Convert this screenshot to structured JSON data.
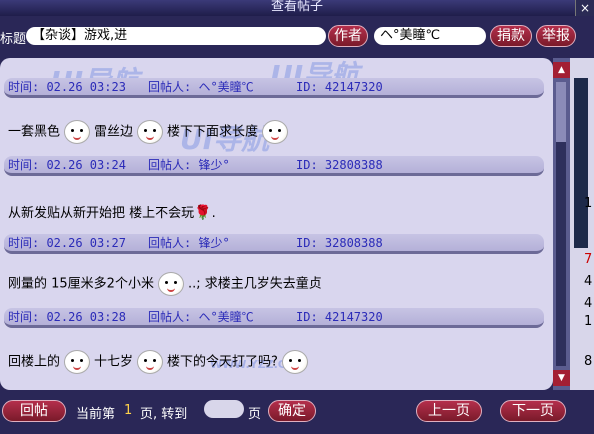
{
  "window": {
    "title": "查看帖子",
    "close_glyph": "×"
  },
  "header": {
    "title_label": "标题",
    "title_value": "【杂谈】游戏,进",
    "author_button": "作者",
    "author_value": "ヘ°美瞳℃",
    "donate_button": "捐款",
    "report_button": "举报"
  },
  "posts": [
    {
      "time": "时间: 02.26 03:23",
      "poster": "回帖人: ヘ°美瞳℃",
      "id": "ID: 42147320",
      "text_parts": [
        "一套黑色",
        "雷丝边",
        "楼下下面求长度"
      ]
    },
    {
      "time": "时间: 02.26 03:24",
      "poster": "回帖人: 锋少°",
      "id": "ID: 32808388",
      "text_parts": [
        "从新发贴从新开始把  楼上不会玩",
        "."
      ]
    },
    {
      "time": "时间: 02.26 03:27",
      "poster": "回帖人: 锋少°",
      "id": "ID: 32808388",
      "text_parts": [
        "刚量的 15厘米多2个小米",
        "..; 求楼主几岁失去童贞"
      ]
    },
    {
      "time": "时间: 02.26 03:28",
      "poster": "回帖人: ヘ°美瞳℃",
      "id": "ID: 42147320",
      "text_parts": [
        "回楼上的",
        "十七岁",
        "楼下的今天打了吗?"
      ]
    }
  ],
  "watermark": {
    "logo": "UI导航",
    "site": "WWW.YZZ.CN"
  },
  "right_strip": [
    "1",
    "7",
    "4",
    "4",
    "1",
    "8"
  ],
  "footer": {
    "reply_button": "回帖",
    "page_text_a": "当前第",
    "page_number": "1",
    "page_text_b": "页, 转到",
    "page_text_c": "页",
    "confirm_button": "确定",
    "prev_button": "上一页",
    "next_button": "下一页"
  },
  "colors": {
    "accent": "#a31f33",
    "meta_text": "#2b2bb8",
    "panel_bg": "#d9d6ee"
  }
}
